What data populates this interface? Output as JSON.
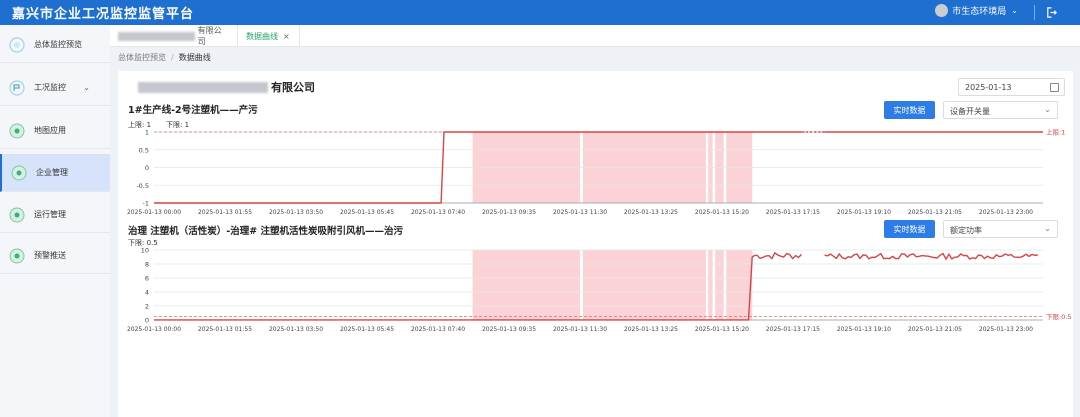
{
  "header": {
    "title": "嘉兴市企业工况监控监管平台",
    "user": "市生态环境局"
  },
  "sidebar": {
    "items": [
      {
        "label": "总体监控预览"
      },
      {
        "label": "工况监控"
      },
      {
        "label": "地图应用"
      },
      {
        "label": "企业管理"
      },
      {
        "label": "运行管理"
      },
      {
        "label": "预警推送"
      }
    ]
  },
  "tabs": [
    {
      "label": "有限公司"
    },
    {
      "label": "数据曲线",
      "close": "×"
    }
  ],
  "breadcrumb": {
    "parent": "总体监控预览",
    "sep": "/",
    "current": "数据曲线"
  },
  "company": {
    "name_suffix": "有限公司"
  },
  "date_picker": {
    "value": "2025-01-13"
  },
  "sections": [
    {
      "title": "1#生产线-2号注塑机——产污",
      "button": "实时数据",
      "select": "设备开关量",
      "upper_label": "上限: 1",
      "lower_label": "下限: 1"
    },
    {
      "title": "治理  注塑机（活性炭）-治理#  注塑机活性炭吸附引风机——治污",
      "button": "实时数据",
      "select": "额定功率",
      "lower_label": "下限: 0.5"
    }
  ],
  "chart_data": [
    {
      "type": "line",
      "x_ticks": [
        "2025-01-13 00:00",
        "2025-01-13 01:55",
        "2025-01-13 03:50",
        "2025-01-13 05:45",
        "2025-01-13 07:40",
        "2025-01-13 09:35",
        "2025-01-13 11:30",
        "2025-01-13 13:25",
        "2025-01-13 15:20",
        "2025-01-13 17:15",
        "2025-01-13 19:10",
        "2025-01-13 21:05",
        "2025-01-13 23:00"
      ],
      "y_ticks": [
        "1",
        "0.5",
        "0",
        "-0.5",
        "-1"
      ],
      "ylim": [
        -1,
        1
      ],
      "threshold": {
        "value": 1,
        "label": "上限:1"
      },
      "series": [
        {
          "points": [
            [
              0,
              -1
            ],
            [
              7.75,
              -1
            ],
            [
              7.83,
              1
            ],
            [
              17.5,
              1
            ]
          ],
          "gap": [
            17.5,
            18.1
          ],
          "points2": [
            [
              18.1,
              1
            ],
            [
              24,
              1
            ]
          ]
        }
      ],
      "shaded": [
        [
          8.6,
          11.5
        ],
        [
          11.58,
          14.9
        ],
        [
          14.96,
          15.08
        ],
        [
          15.15,
          15.38
        ],
        [
          15.45,
          16.15
        ]
      ],
      "colors": {
        "line": "#d64545",
        "shade": "#fbd3d6"
      }
    },
    {
      "type": "line",
      "x_ticks": [
        "2025-01-13 00:00",
        "2025-01-13 01:55",
        "2025-01-13 03:50",
        "2025-01-13 05:45",
        "2025-01-13 07:40",
        "2025-01-13 09:35",
        "2025-01-13 11:30",
        "2025-01-13 13:25",
        "2025-01-13 15:20",
        "2025-01-13 17:15",
        "2025-01-13 19:10",
        "2025-01-13 21:05",
        "2025-01-13 23:00"
      ],
      "y_ticks": [
        "10",
        "8",
        "6",
        "4",
        "2",
        "0"
      ],
      "ylim": [
        0,
        10
      ],
      "threshold": {
        "value": 0.5,
        "label": "下限:0.5"
      },
      "shaded": [
        [
          8.6,
          11.5
        ],
        [
          11.58,
          14.9
        ],
        [
          14.96,
          15.08
        ],
        [
          15.15,
          15.38
        ],
        [
          15.45,
          16.15
        ]
      ],
      "colors": {
        "line": "#d64545",
        "shade": "#fbd3d6"
      }
    }
  ]
}
